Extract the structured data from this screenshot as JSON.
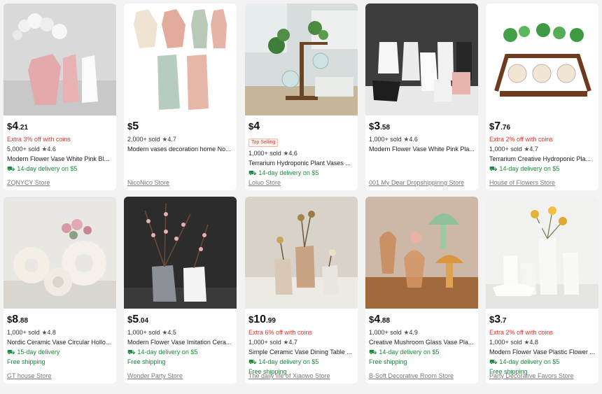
{
  "currency": "$",
  "products": [
    {
      "price_whole": "4",
      "price_cents": ".21",
      "promo": "Extra 3% off with coins",
      "badge": "",
      "sold": "5,000+ sold",
      "rating": "4.6",
      "title": "Modern Flower Vase White Pink Bl...",
      "delivery": "14-day delivery on $5",
      "shipping": "",
      "store": "ZQNYCY Store"
    },
    {
      "price_whole": "5",
      "price_cents": "",
      "promo": "",
      "badge": "",
      "sold": "2,000+ sold",
      "rating": "4.7",
      "title": "Modern vases decoration home No...",
      "delivery": "",
      "shipping": "",
      "store": "NicoNico Store"
    },
    {
      "price_whole": "4",
      "price_cents": "",
      "promo": "",
      "badge": "Top Selling",
      "sold": "1,000+ sold",
      "rating": "4.6",
      "title": "Terrarium Hydroponic Plant Vases ...",
      "delivery": "14-day delivery on $5",
      "shipping": "",
      "store": "Loluo Store"
    },
    {
      "price_whole": "3",
      "price_cents": ".58",
      "promo": "",
      "badge": "",
      "sold": "1,000+ sold",
      "rating": "4.6",
      "title": "Modern Flower Vase White Pink Pla...",
      "delivery": "",
      "shipping": "",
      "store": "001 My Dear Dropshippinng Store"
    },
    {
      "price_whole": "7",
      "price_cents": ".76",
      "promo": "Extra 2% off with coins",
      "badge": "",
      "sold": "1,000+ sold",
      "rating": "4.7",
      "title": "Terrarium Creative Hydroponic Pla...",
      "delivery": "14-day delivery on $5",
      "shipping": "",
      "store": "House of Flowers Store"
    },
    {
      "price_whole": "8",
      "price_cents": ".88",
      "promo": "",
      "badge": "",
      "sold": "1,000+ sold",
      "rating": "4.8",
      "title": "Nordic Ceramic Vase Circular Hollo...",
      "delivery": "15-day delivery",
      "shipping": "Free shipping",
      "store": "GT house Store"
    },
    {
      "price_whole": "5",
      "price_cents": ".04",
      "promo": "",
      "badge": "",
      "sold": "1,000+ sold",
      "rating": "4.5",
      "title": "Modern Flower Vase Imitation Cera...",
      "delivery": "14-day delivery on $5",
      "shipping": "Free shipping",
      "store": "Wonder Party Store"
    },
    {
      "price_whole": "10",
      "price_cents": ".99",
      "promo": "Extra 6% off with coins",
      "badge": "",
      "sold": "1,000+ sold",
      "rating": "4.7",
      "title": "Simple Ceramic Vase Dining Table ...",
      "delivery": "14-day delivery on $5",
      "shipping": "Free shipping",
      "store": "The daily life of Xiaowo Store"
    },
    {
      "price_whole": "4",
      "price_cents": ".88",
      "promo": "",
      "badge": "",
      "sold": "1,000+ sold",
      "rating": "4.9",
      "title": "Creative Mushroom Glass Vase Pla...",
      "delivery": "14-day delivery on $5",
      "shipping": "Free shipping",
      "store": "B-Soft Decorative Room Store"
    },
    {
      "price_whole": "3",
      "price_cents": ".7",
      "promo": "Extra 2% off with coins",
      "badge": "",
      "sold": "1,000+ sold",
      "rating": "4.8",
      "title": "Modern Flower Vase Plastic Flower ...",
      "delivery": "14-day delivery on $5",
      "shipping": "Free shipping",
      "store": "Party Decorative Favors Store"
    }
  ],
  "colors": {
    "promo_red": "#e0332b",
    "delivery_green": "#1a8a3a",
    "badge_red": "#d83a22"
  }
}
